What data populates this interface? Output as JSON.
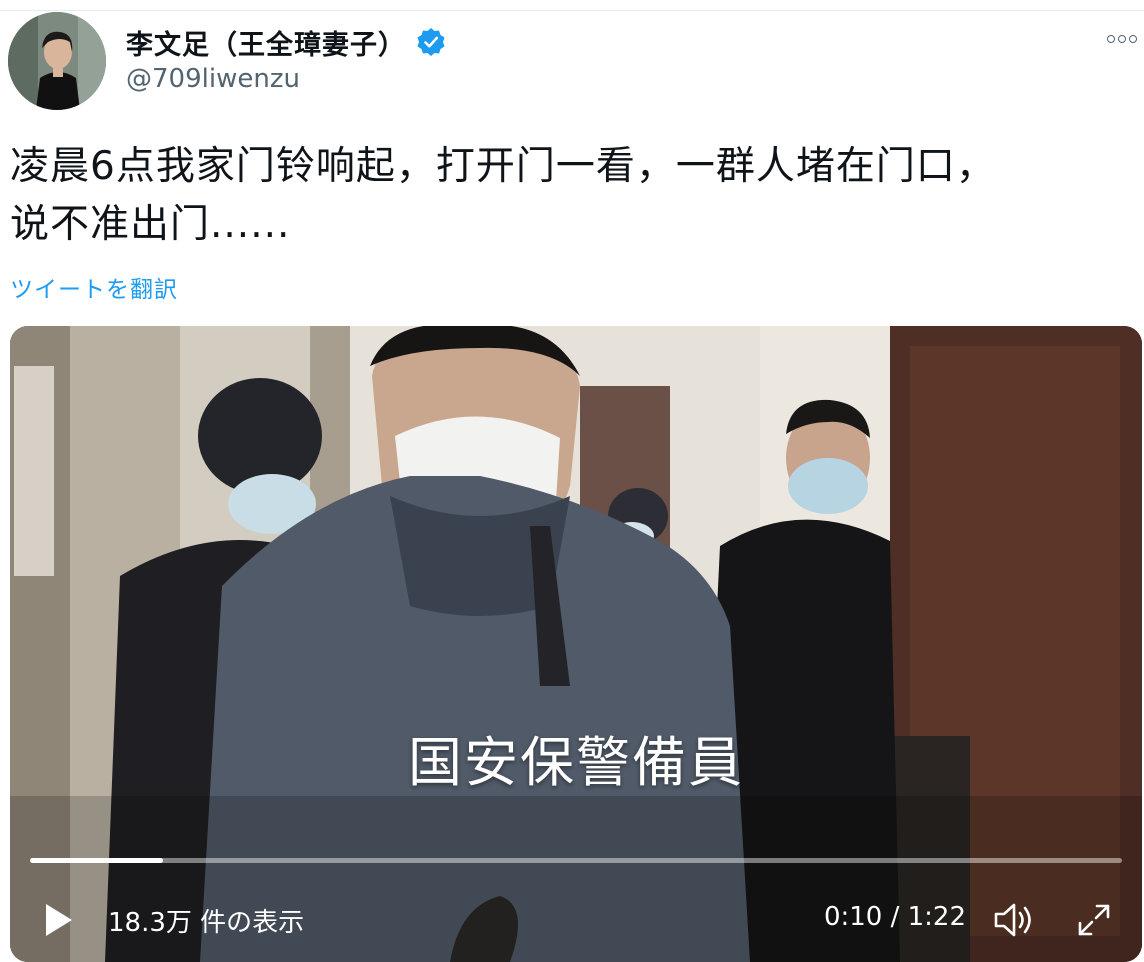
{
  "tweet": {
    "display_name": "李文足（王全璋妻子）",
    "handle": "@709liwenzu",
    "text_line1": "凌晨6点我家门铃响起，打开门一看，一群人堵在门口，",
    "text_line2": "说不准出门......",
    "translate_label": "ツイートを翻訳"
  },
  "icons": {
    "verified": "verified-badge-icon",
    "more": "more-options-icon",
    "play": "play-icon",
    "volume": "volume-icon",
    "fullscreen": "fullscreen-icon"
  },
  "video": {
    "subtitle": "国安保警備員",
    "views": "18.3万 件の表示",
    "current_time": "0:10",
    "duration": "1:22",
    "time_display": "0:10 / 1:22",
    "progress_fraction": 0.122
  },
  "colors": {
    "accent": "#1d9bf0",
    "text": "#0f1419",
    "secondary": "#536471"
  }
}
